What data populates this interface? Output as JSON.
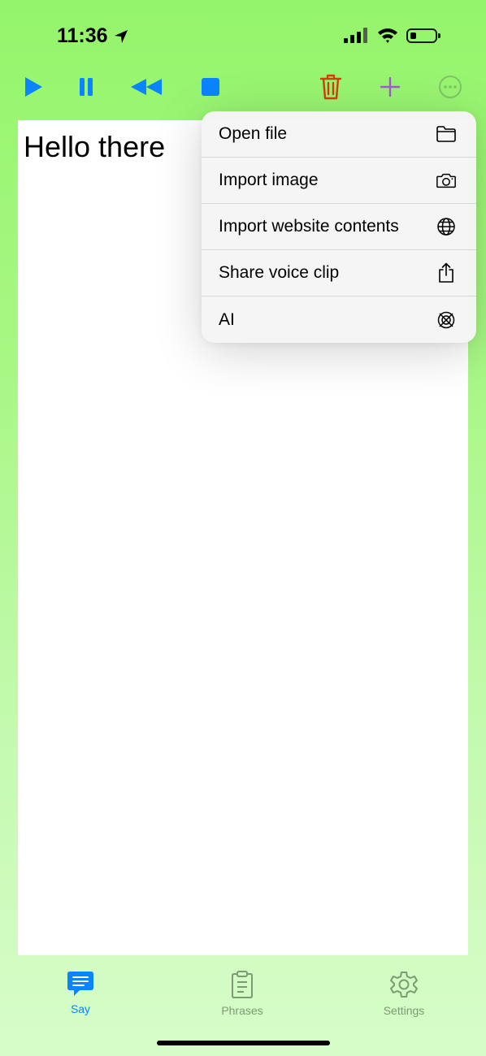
{
  "status_bar": {
    "time": "11:36"
  },
  "toolbar": {
    "play_icon": "play-icon",
    "pause_icon": "pause-icon",
    "rewind_icon": "rewind-icon",
    "stop_icon": "stop-icon",
    "trash_icon": "trash-icon",
    "add_icon": "plus-icon",
    "more_icon": "ellipsis-circle-icon",
    "colors": {
      "media": "#0a84ff",
      "trash": "#d1410a",
      "add": "#a259d9",
      "more": "#7fc46a"
    }
  },
  "editor": {
    "text": "Hello there"
  },
  "menu": {
    "items": [
      {
        "label": "Open file",
        "icon": "folder-icon"
      },
      {
        "label": "Import image",
        "icon": "camera-icon"
      },
      {
        "label": "Import website contents",
        "icon": "globe-icon"
      },
      {
        "label": "Share voice clip",
        "icon": "share-icon"
      },
      {
        "label": "AI",
        "icon": "ai-icon"
      }
    ]
  },
  "tabbar": {
    "tabs": [
      {
        "label": "Say",
        "icon": "speech-bubble-icon",
        "active": true
      },
      {
        "label": "Phrases",
        "icon": "clipboard-icon",
        "active": false
      },
      {
        "label": "Settings",
        "icon": "gear-icon",
        "active": false
      }
    ],
    "colors": {
      "active": "#0a84ff",
      "inactive": "#7c9b72"
    }
  }
}
